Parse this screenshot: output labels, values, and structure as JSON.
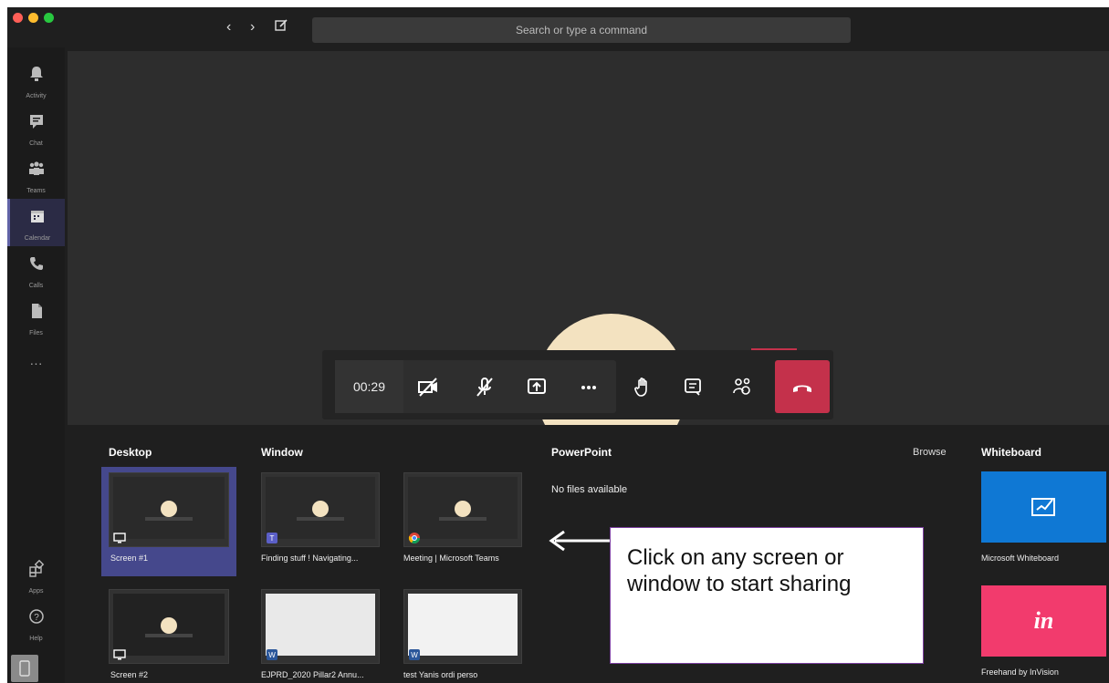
{
  "window": {
    "search_placeholder": "Search or type a command"
  },
  "rail": {
    "items": [
      {
        "label": "Activity",
        "icon": "bell-icon"
      },
      {
        "label": "Chat",
        "icon": "chat-icon"
      },
      {
        "label": "Teams",
        "icon": "teams-icon"
      },
      {
        "label": "Calendar",
        "icon": "calendar-icon"
      },
      {
        "label": "Calls",
        "icon": "phone-icon"
      },
      {
        "label": "Files",
        "icon": "file-icon"
      },
      {
        "label": "Apps",
        "icon": "apps-icon"
      },
      {
        "label": "Help",
        "icon": "help-icon"
      }
    ],
    "more": "···"
  },
  "call": {
    "timer": "00:29"
  },
  "share": {
    "desktop_title": "Desktop",
    "window_title": "Window",
    "powerpoint_title": "PowerPoint",
    "browse_label": "Browse",
    "whiteboard_title": "Whiteboard",
    "no_files": "No files available",
    "desktop_items": [
      "Screen #1",
      "Screen #2"
    ],
    "window_items": [
      "Finding stuff ! Navigating...",
      "Meeting | Microsoft Teams",
      "EJPRD_2020 Pillar2 Annu...",
      "test Yanis ordi perso"
    ],
    "whiteboard_items": [
      "Microsoft Whiteboard",
      "Freehand by InVision"
    ],
    "invision_logo": "in"
  },
  "callout": {
    "text": "Click on any screen or window to start sharing"
  },
  "colors": {
    "accent": "#6264a7",
    "hangup": "#c4314b",
    "whiteboard": "#0f78d4",
    "invision": "#f23b6d"
  }
}
